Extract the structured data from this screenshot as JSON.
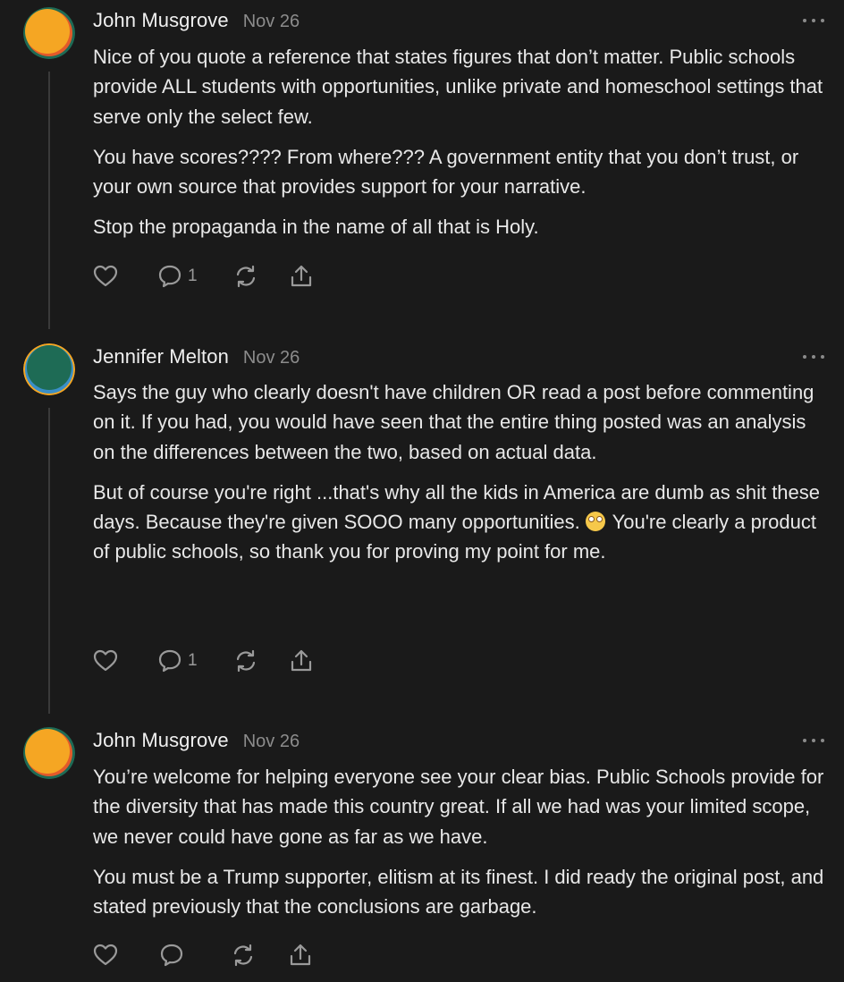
{
  "comments": [
    {
      "author": "John Musgrove",
      "date": "Nov 26",
      "avatar": "orange-green-avatar",
      "paragraphs": [
        "Nice of you quote a reference that states figures that don’t matter. Public schools provide ALL students with opportunities, unlike private and homeschool settings that serve only the select few.",
        "You have scores???? From where??? A government entity that you don’t trust, or your own source that provides support for your narrative.",
        "Stop the propaganda in the name of all that is Holy."
      ],
      "reply_count": "1"
    },
    {
      "author": "Jennifer Melton",
      "date": "Nov 26",
      "avatar": "green-orange-avatar",
      "paragraphs": [
        "Says the guy who clearly doesn't have children OR read a post before commenting on it. If you had, you would have seen that the entire thing posted was an analysis on the differences between the two, based on actual data."
      ],
      "paragraph2_before_emoji": "But of course you're right ...that's why all the kids in America are dumb as shit these days. Because they're given SOOO many opportunities.",
      "emoji": "eye-roll-emoji",
      "paragraph2_after_emoji": "You're clearly a product of public schools, so thank you for proving my point for me.",
      "reply_count": "1"
    },
    {
      "author": "John Musgrove",
      "date": "Nov 26",
      "avatar": "orange-green-avatar",
      "paragraphs": [
        "You’re welcome for helping everyone see your clear bias. Public Schools provide for the diversity that has made this country great. If all we had was your limited scope, we never could have gone as far as we have.",
        "You must be a Trump supporter, elitism at its finest. I did ready the original post, and stated previously that the conclusions are garbage."
      ],
      "reply_count": ""
    }
  ],
  "colors": {
    "background": "#1a1a1a",
    "text": "#e8e8e8",
    "muted": "#8c8c8c",
    "avatar_orange": "#f5a623",
    "avatar_green": "#1e6b55"
  },
  "icons": [
    "heart-icon",
    "comment-icon",
    "restack-icon",
    "share-icon",
    "more-options-icon"
  ]
}
